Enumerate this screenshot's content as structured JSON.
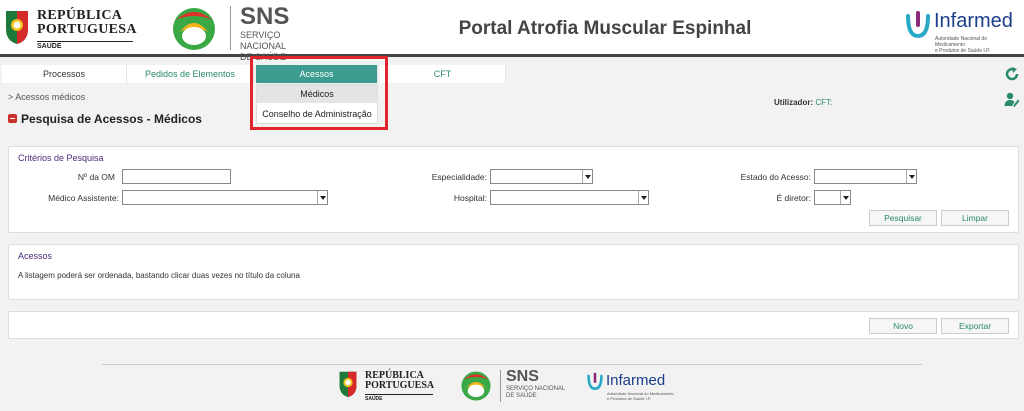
{
  "header": {
    "rep_logo": {
      "line1": "REPÚBLICA",
      "line2": "PORTUGUESA",
      "sub": "SAÚDE"
    },
    "sns_logo": {
      "title": "SNS",
      "sub1": "SERVIÇO NACIONAL",
      "sub2": "DE SAÚDE"
    },
    "portal_title": "Portal Atrofia Muscular Espinhal",
    "infarmed_logo": {
      "name": "Infarmed",
      "sub1": "Autoridade Nacional do Medicamento",
      "sub2": "e Produtos de Saúde I.P."
    }
  },
  "nav": {
    "tabs": [
      {
        "label": "Processos"
      },
      {
        "label": "Pedidos de Elementos"
      },
      {
        "label": "Acessos"
      },
      {
        "label": "CFT"
      }
    ],
    "refresh_icon": "refresh-icon"
  },
  "submenu": {
    "items": [
      {
        "label": "Médicos"
      },
      {
        "label": "Conselho de Administração"
      }
    ]
  },
  "breadcrumb": "> Acessos médicos",
  "user": {
    "label": "Utilizador:",
    "value": "CFT:"
  },
  "page_title": "Pesquisa de Acessos - Médicos",
  "criteria": {
    "title": "Critérios de Pesquisa",
    "om_label": "Nº da OM",
    "om_value": "",
    "especialidade_label": "Especialidade:",
    "especialidade_value": "",
    "estado_label": "Estado do Acesso:",
    "estado_value": "",
    "medico_label": "Médico Assistente:",
    "medico_value": "",
    "hospital_label": "Hospital:",
    "hospital_value": "",
    "diretor_label": "É diretor:",
    "diretor_value": "",
    "search_button": "Pesquisar",
    "clear_button": "Limpar"
  },
  "acessos": {
    "title": "Acessos",
    "info": "A listagem poderá ser ordenada, bastando clicar duas vezes no título da coluna"
  },
  "actions": {
    "new_button": "Novo",
    "export_button": "Exportar"
  },
  "footer": {
    "rep_line1": "REPÚBLICA",
    "rep_line2": "PORTUGUESA",
    "rep_sub": "SAÚDE",
    "sns_title": "SNS",
    "sns_sub1": "SERVIÇO NACIONAL",
    "sns_sub2": "DE SAÚDE",
    "inf_name": "Infarmed",
    "inf_sub1": "Autoridade Nacional do Medicamento",
    "inf_sub2": "e Produtos de Saúde I.P."
  },
  "colors": {
    "accent": "#3b9c8f",
    "link": "#2a8a6c",
    "highlight": "#e0262c",
    "section_title": "#4a2b7a"
  }
}
